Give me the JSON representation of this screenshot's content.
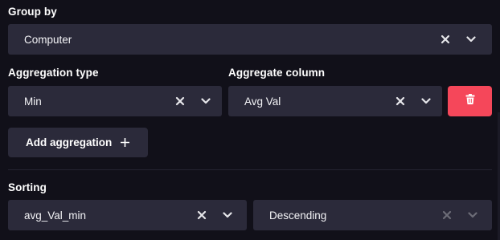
{
  "group_by": {
    "label": "Group by",
    "value": "Computer",
    "icons": {
      "clear": "close-icon",
      "expand": "chevron-down-icon"
    }
  },
  "aggregation": {
    "type_label": "Aggregation type",
    "type_value": "Min",
    "column_label": "Aggregate column",
    "column_value": "Avg Val",
    "delete_icon": "trash-icon",
    "delete_color": "#f5475a"
  },
  "add_aggregation": {
    "label": "Add aggregation",
    "icon": "plus-icon"
  },
  "sorting": {
    "label": "Sorting",
    "column_value": "avg_Val_min",
    "direction_value": "Descending"
  },
  "colors": {
    "background": "#111019",
    "field": "#2b2a3a",
    "accent_danger": "#f5475a"
  }
}
